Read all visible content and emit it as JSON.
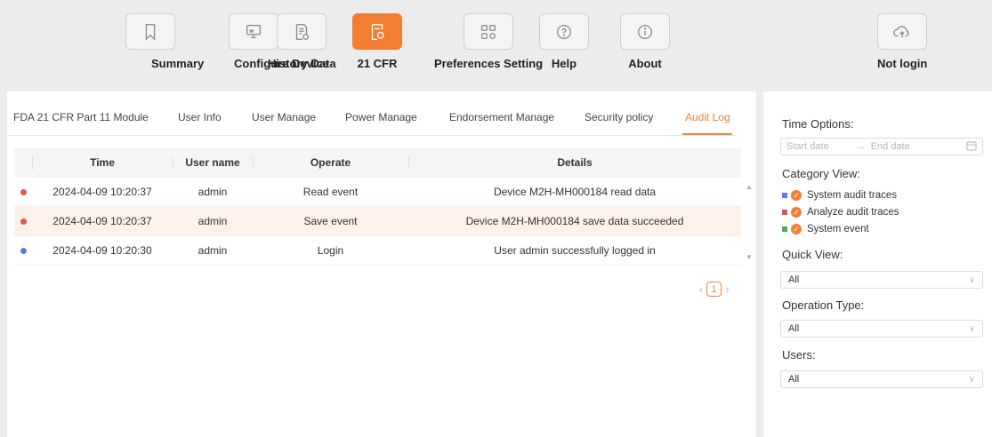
{
  "toolbar": {
    "items": [
      {
        "label": "Summary",
        "icon": "bookmark-icon"
      },
      {
        "label": "Configure Device",
        "icon": "monitor-icon"
      },
      {
        "label": "History Data",
        "icon": "history-doc-icon"
      },
      {
        "label": "21 CFR",
        "icon": "cfr-doc-icon"
      },
      {
        "label": "Preferences Setting",
        "icon": "grid-icon"
      },
      {
        "label": "Help",
        "icon": "question-icon"
      },
      {
        "label": "About",
        "icon": "info-icon"
      }
    ],
    "login_label": "Not login",
    "login_icon": "cloud-upload-icon",
    "active_item": "21 CFR",
    "accent_color": "#f27e34"
  },
  "tabs": [
    "FDA 21 CFR Part 11 Module",
    "User Info",
    "User Manage",
    "Power Manage",
    "Endorsement Manage",
    "Security policy",
    "Audit Log"
  ],
  "active_tab": "Audit Log",
  "table": {
    "headers": [
      "Time",
      "User name",
      "Operate",
      "Details"
    ],
    "rows": [
      {
        "time": "2024-04-09 10:20:37",
        "user": "admin",
        "operate": "Read event",
        "details": "Device M2H-MH000184 read data",
        "dot_color": "#e05555"
      },
      {
        "time": "2024-04-09 10:20:37",
        "user": "admin",
        "operate": "Save event",
        "details": "Device M2H-MH000184 save data succeeded",
        "dot_color": "#e05555"
      },
      {
        "time": "2024-04-09 10:20:30",
        "user": "admin",
        "operate": "Login",
        "details": "User admin successfully logged in",
        "dot_color": "#5b7fe0"
      }
    ]
  },
  "pagination": {
    "current_page": "1"
  },
  "side": {
    "time_options_label": "Time Options:",
    "start_placeholder": "Start date",
    "end_placeholder": "End date",
    "category_label": "Category View:",
    "categories": [
      {
        "label": "System audit traces",
        "color": "#5b7fe0",
        "checked": true
      },
      {
        "label": "Analyze audit traces",
        "color": "#e05555",
        "checked": true
      },
      {
        "label": "System event",
        "color": "#3cb44b",
        "checked": true
      }
    ],
    "quick_view_label": "Quick View:",
    "quick_view_value": "All",
    "operation_type_label": "Operation Type:",
    "operation_type_value": "All",
    "users_label": "Users:",
    "users_value": "All"
  }
}
